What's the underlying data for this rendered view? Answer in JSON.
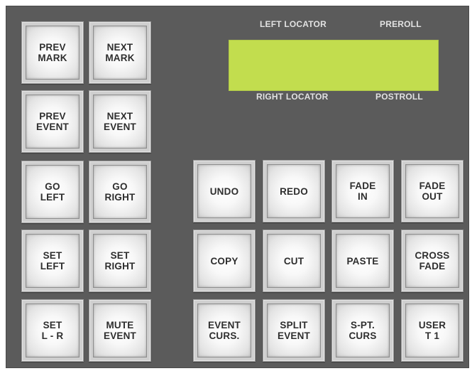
{
  "display": {
    "left_locator_label": "LEFT LOCATOR",
    "preroll_label": "PREROLL",
    "right_locator_label": "RIGHT LOCATOR",
    "postroll_label": "POSTROLL",
    "screen_color": "#c2dd4e"
  },
  "left_keys": {
    "prev_mark": "PREV\nMARK",
    "next_mark": "NEXT\nMARK",
    "prev_event": "PREV\nEVENT",
    "next_event": "NEXT\nEVENT",
    "go_left": "GO\nLEFT",
    "go_right": "GO\nRIGHT",
    "set_left": "SET\nLEFT",
    "set_right": "SET\nRIGHT",
    "set_l_r": "SET\nL - R",
    "mute_event": "MUTE\nEVENT"
  },
  "edit_keys": {
    "undo": "UNDO",
    "redo": "REDO",
    "fade_in": "FADE\nIN",
    "fade_out": "FADE\nOUT",
    "copy": "COPY",
    "cut": "CUT",
    "paste": "PASTE",
    "cross_fade": "CROSS\nFADE",
    "event_curs": "EVENT\nCURS.",
    "split_event": "SPLIT\nEVENT",
    "s_pt_curs": "S-PT.\nCURS",
    "user_t1": "USER\nT 1"
  },
  "colors": {
    "panel": "#5b5b5b",
    "key_face": "#f8f8f8",
    "key_text": "#2e2e2e",
    "caption_text": "#e2e2e2"
  }
}
